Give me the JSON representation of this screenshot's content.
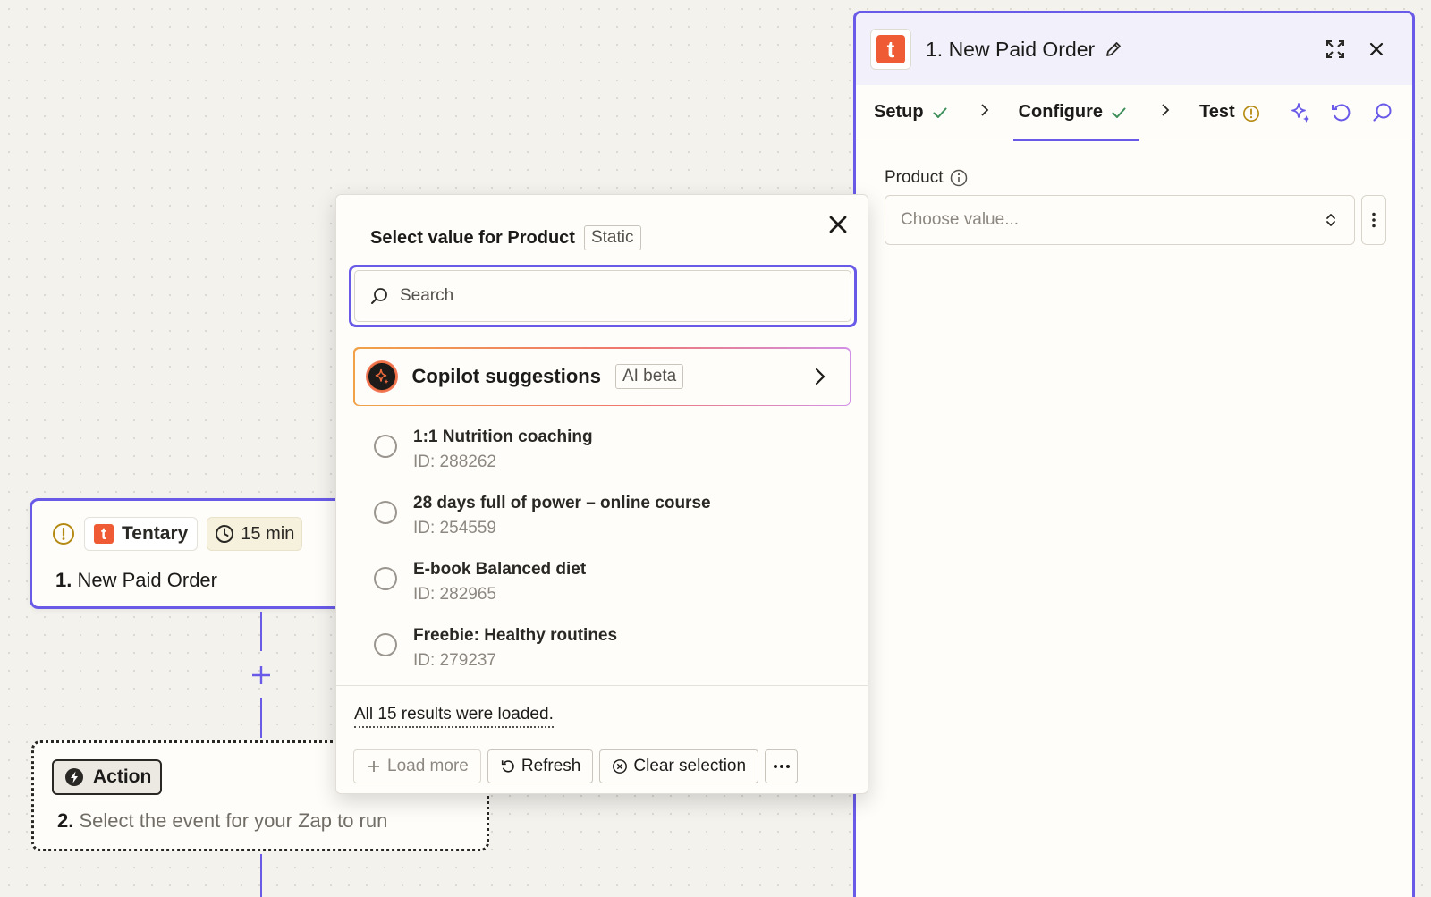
{
  "canvas": {
    "trigger": {
      "app_name": "Tentary",
      "app_letter": "t",
      "interval": "15 min",
      "step_number": "1.",
      "title": "New Paid Order"
    },
    "action": {
      "chip_label": "Action",
      "step_number": "2.",
      "placeholder_title": "Select the event for your Zap to run"
    }
  },
  "panel": {
    "app_letter": "t",
    "title": "1. New Paid Order",
    "tabs": [
      {
        "label": "Setup",
        "status": "complete"
      },
      {
        "label": "Configure",
        "status": "complete"
      },
      {
        "label": "Test",
        "status": "warning"
      }
    ],
    "field_label": "Product",
    "select_placeholder": "Choose value..."
  },
  "popover": {
    "title": "Select value for Product",
    "badge": "Static",
    "search_placeholder": "Search",
    "copilot_label": "Copilot suggestions",
    "copilot_badge": "AI beta",
    "options": [
      {
        "name": "1:1 Nutrition coaching",
        "id": "ID: 288262"
      },
      {
        "name": "28 days full of power – online course",
        "id": "ID: 254559"
      },
      {
        "name": "E-book Balanced diet",
        "id": "ID: 282965"
      },
      {
        "name": "Freebie: Healthy routines",
        "id": "ID: 279237"
      }
    ],
    "status": "All 15 results were loaded.",
    "buttons": {
      "load_more": "Load more",
      "refresh": "Refresh",
      "clear": "Clear selection"
    }
  },
  "colors": {
    "accent": "#695be8",
    "brand": "#ef5b34",
    "success": "#3d8f5a",
    "warning": "#b58a12"
  }
}
